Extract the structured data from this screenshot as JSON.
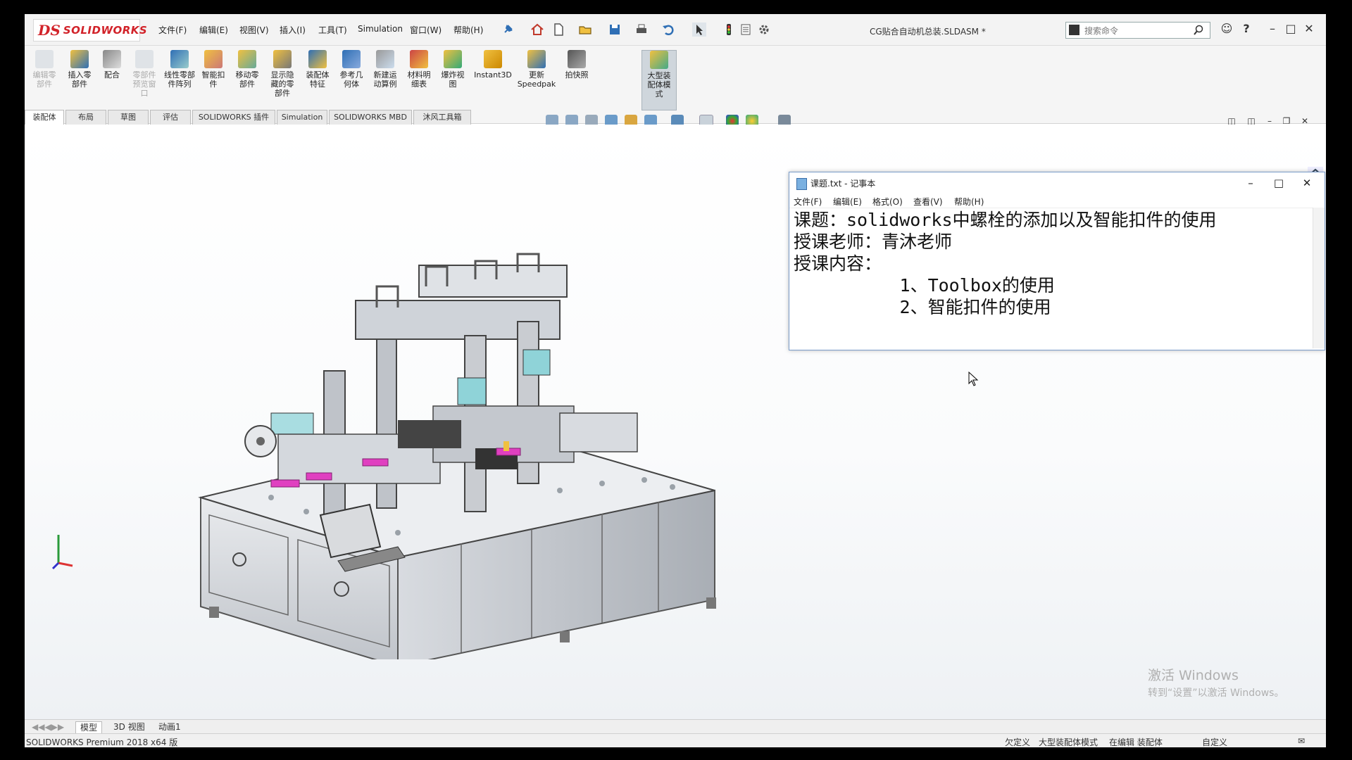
{
  "app": {
    "logo_ds": "DS",
    "logo_text": "SOLIDWORKS",
    "document_title": "CG贴合自动机总装.SLDASM *",
    "edition": "SOLIDWORKS Premium 2018 x64 版"
  },
  "menu": [
    "文件(F)",
    "编辑(E)",
    "视图(V)",
    "插入(I)",
    "工具(T)",
    "Simulation",
    "窗口(W)",
    "帮助(H)"
  ],
  "search": {
    "placeholder": "搜索命令"
  },
  "ribbon": [
    {
      "label": "编辑零\n部件",
      "icon": "edit-component-icon",
      "enabled": false
    },
    {
      "label": "插入零\n部件",
      "icon": "insert-component-icon",
      "enabled": true
    },
    {
      "label": "配合",
      "icon": "mate-icon",
      "enabled": true
    },
    {
      "label": "零部件\n预览窗\n口",
      "icon": "component-preview-icon",
      "enabled": false
    },
    {
      "label": "线性零部\n件阵列",
      "icon": "linear-pattern-icon",
      "enabled": true
    },
    {
      "label": "智能扣\n件",
      "icon": "smart-fasteners-icon",
      "enabled": true
    },
    {
      "label": "移动零\n部件",
      "icon": "move-component-icon",
      "enabled": true
    },
    {
      "label": "显示隐\n藏的零\n部件",
      "icon": "show-hidden-icon",
      "enabled": true
    },
    {
      "label": "装配体\n特征",
      "icon": "assembly-feature-icon",
      "enabled": true
    },
    {
      "label": "参考几\n何体",
      "icon": "reference-geometry-icon",
      "enabled": true
    },
    {
      "label": "新建运\n动算例",
      "icon": "motion-study-icon",
      "enabled": true
    },
    {
      "label": "材料明\n细表",
      "icon": "bom-icon",
      "enabled": true
    },
    {
      "label": "爆炸视\n图",
      "icon": "exploded-view-icon",
      "enabled": true
    },
    {
      "label": "Instant3D",
      "icon": "instant3d-icon",
      "enabled": true
    },
    {
      "label": "更新\nSpeedpak",
      "icon": "speedpak-icon",
      "enabled": true
    },
    {
      "label": "拍快照",
      "icon": "snapshot-icon",
      "enabled": true
    },
    {
      "label": "大型装\n配体模\n式",
      "icon": "large-assembly-icon",
      "enabled": true
    }
  ],
  "command_tabs": [
    "装配体",
    "布局",
    "草图",
    "评估",
    "SOLIDWORKS 插件",
    "Simulation",
    "SOLIDWORKS MBD",
    "沐风工具箱"
  ],
  "notepad": {
    "title": "课题.txt - 记事本",
    "menu": [
      "文件(F)",
      "编辑(E)",
      "格式(O)",
      "查看(V)",
      "帮助(H)"
    ],
    "lines": [
      "课题：solidworks中螺栓的添加以及智能扣件的使用",
      "授课老师：青沐老师",
      "授课内容：",
      "          1、Toolbox的使用",
      "          2、智能扣件的使用"
    ]
  },
  "watermark": {
    "line1": "激活 Windows",
    "line2": "转到“设置”以激活 Windows。"
  },
  "bottom_tabs": [
    "模型",
    "3D 视图",
    "动画1"
  ],
  "status": [
    "欠定义",
    "大型装配体模式",
    "在编辑 装配体",
    "自定义"
  ],
  "colors": {
    "brand": "#d2232a",
    "accent": "#2f6fb5",
    "machine_frame": "#c9ccd1",
    "magenta_part": "#e040c0"
  }
}
